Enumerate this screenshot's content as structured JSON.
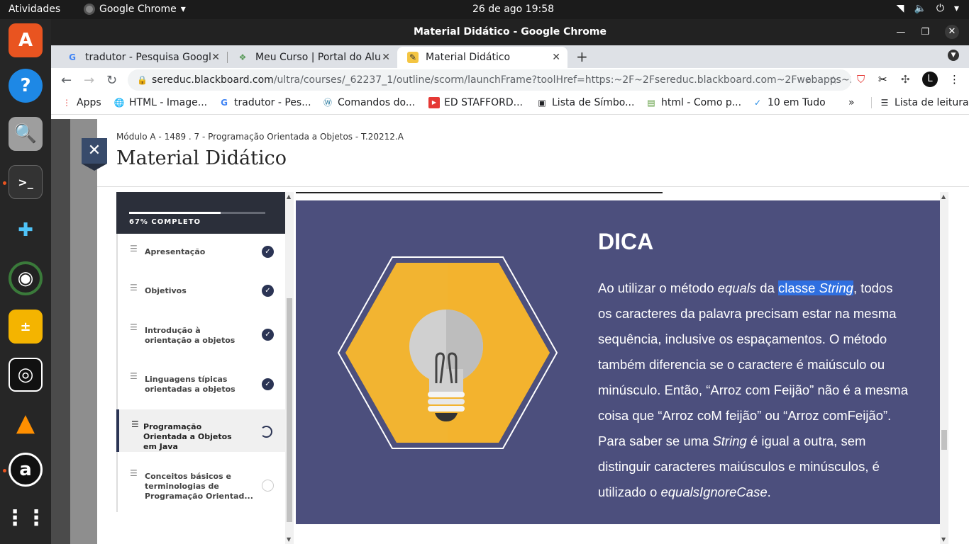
{
  "topbar": {
    "activities": "Atividades",
    "app_name": "Google Chrome",
    "clock": "26 de ago  19:58"
  },
  "window": {
    "title": "Material Didático - Google Chrome"
  },
  "tabs": [
    {
      "label": "tradutor - Pesquisa Googl",
      "icon": "google-icon"
    },
    {
      "label": "Meu Curso | Portal do Alu",
      "icon": "portal-icon"
    },
    {
      "label": "Material Didático",
      "icon": "pencil-icon"
    }
  ],
  "omnibox": {
    "domain": "sereduc.blackboard.com",
    "path": "/ultra/courses/_62237_1/outline/scorm/launchFrame?toolHref=https:~2F~2Fsereduc.blackboard.com~2Fwebapps~2F..."
  },
  "bookmarks": [
    {
      "label": "Apps",
      "icon": "apps-grid-icon"
    },
    {
      "label": "HTML - Image...",
      "icon": "globe-icon"
    },
    {
      "label": "tradutor - Pes...",
      "icon": "google-icon"
    },
    {
      "label": "Comandos do...",
      "icon": "wordpress-icon"
    },
    {
      "label": "ED STAFFORD...",
      "icon": "youtube-icon"
    },
    {
      "label": "Lista de Símbo...",
      "icon": "bookmark-icon"
    },
    {
      "label": "html - Como p...",
      "icon": "stackexchange-icon"
    },
    {
      "label": "10 em Tudo",
      "icon": "checkmark-icon"
    }
  ],
  "reading_list": "Lista de leitura",
  "more_bookmarks": "»",
  "page": {
    "breadcrumb": "Módulo A - 1489 . 7 - Programação Orientada a Objetos - T.20212.A",
    "title": "Material Didático",
    "close_symbol": "✕"
  },
  "sidebar": {
    "progress_label": "67% COMPLETO",
    "progress_fraction": 0.67,
    "lessons": [
      {
        "label": "Apresentação",
        "status": "done"
      },
      {
        "label": "Objetivos",
        "status": "done"
      },
      {
        "label": "Introdução à orientação a objetos",
        "status": "done"
      },
      {
        "label": "Linguagens típicas orientadas a objetos",
        "status": "done"
      },
      {
        "label": "Programação Orientada a Objetos em Java",
        "status": "in-progress"
      },
      {
        "label": "Conceitos básicos e terminologias de Programação Orientad...",
        "status": "not-started"
      }
    ]
  },
  "callout": {
    "heading": "DICA",
    "p1": "Ao utilizar o método ",
    "equals": "equals",
    "p2": " da ",
    "hl1": "classe ",
    "hl2": "String",
    "p3": ", todos os caracteres da palavra precisam estar na mesma sequência, inclusive os espaçamentos. O método também diferencia se o caractere é maiúsculo ou minúsculo. Então, “Arroz com Feijão” não é a mesma coisa que “Arroz coM feijão” ou “Arroz comFeijão”. Para saber se uma ",
    "string2": "String",
    "p4": " é igual a outra, sem distinguir caracteres maiúsculos e minúsculos, é utilizado o ",
    "eqic": "equalsIgnoreCase",
    "p5": ".",
    "colors": {
      "background": "#4c4f7d",
      "hexagon": "#f2b431",
      "highlight": "#2f6fe0"
    }
  }
}
